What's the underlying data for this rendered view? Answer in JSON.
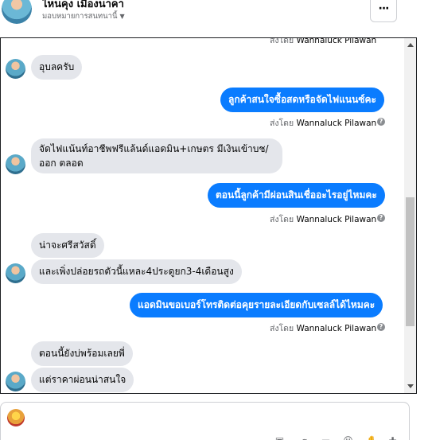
{
  "header": {
    "name": "ไหนคุง เมืองนาคา",
    "subtitle": "มอบหมายการสนทนานี้",
    "more_label": "···"
  },
  "messages": {
    "sent_prefix": "ส่งโดย",
    "sender_name": "Wannaluck Pilawan",
    "top_partial_prefix": "ส่งโดย",
    "top_partial_name": "Wannaluck Pilawan",
    "m1": "อุบลครับ",
    "m2": "ลูกค้าสนใจซื้อสดหรือจัดไฟแนนซ์คะ",
    "m3": "จัดไฟแน้นท์อาชีพฟรีแล้นด์แอดมิน+เกษตร มีเงินเข้าบช/ออก ตลอด",
    "m4": "ตอนนี้ลูกค้ามีผ่อนสินเชื่ออะไรอยู่ไหมคะ",
    "m5": "น่าจะศรีสวัสดิ์",
    "m6": "และเพิ่งปล่อยรถตัวนี้แหละ4ประดูยก3-4เดือนสูง",
    "m7": "แอดมินขอเบอร์โทรติดต่อคุยรายละเอียดกับเซลล์ได้ไหมคะ",
    "m8": "ตอนนี้ยังบ่พร้อมเลยพี่",
    "m9": "แต่ราคาผ่อนน่าสนใจ"
  },
  "icons": {
    "more": "ellipsis-icon",
    "caret": "chevron-down-icon",
    "info": "info-icon",
    "composer_tools": [
      "bag-icon",
      "attachment-icon",
      "gif-icon",
      "emoji-icon",
      "like-icon",
      "more-tools-icon"
    ]
  },
  "colors": {
    "outgoing_bubble": "#0a7cff",
    "incoming_bubble": "#e4e6eb",
    "secondary_text": "#65676b"
  }
}
